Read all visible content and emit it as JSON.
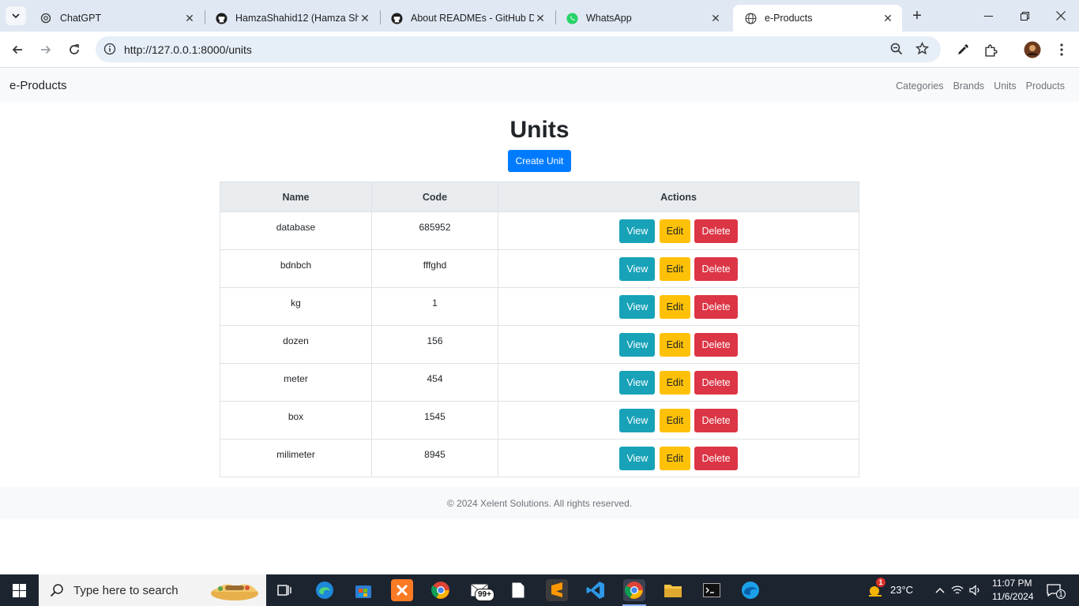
{
  "browser": {
    "tabs": [
      {
        "title": "ChatGPT",
        "icon": "chatgpt-icon"
      },
      {
        "title": "HamzaShahid12 (Hamza Sha",
        "icon": "github-icon"
      },
      {
        "title": "About READMEs - GitHub D",
        "icon": "github-icon"
      },
      {
        "title": "WhatsApp",
        "icon": "whatsapp-icon"
      },
      {
        "title": "e-Products",
        "icon": "globe-icon",
        "active": true
      }
    ],
    "url": "http://127.0.0.1:8000/units"
  },
  "navbar": {
    "brand": "e-Products",
    "links": [
      "Categories",
      "Brands",
      "Units",
      "Products"
    ]
  },
  "page": {
    "title": "Units",
    "create_button": "Create Unit"
  },
  "table": {
    "headers": [
      "Name",
      "Code",
      "Actions"
    ],
    "rows": [
      {
        "name": "database",
        "code": "685952"
      },
      {
        "name": "bdnbch",
        "code": "fffghd"
      },
      {
        "name": "kg",
        "code": "1"
      },
      {
        "name": "dozen",
        "code": "156"
      },
      {
        "name": "meter",
        "code": "454"
      },
      {
        "name": "box",
        "code": "1545"
      },
      {
        "name": "milimeter",
        "code": "8945"
      }
    ],
    "actions": {
      "view": "View",
      "edit": "Edit",
      "delete": "Delete"
    }
  },
  "footer": {
    "text": "© 2024 Xelent Solutions. All rights reserved."
  },
  "colors": {
    "primary": "#007bff",
    "info": "#17a2b8",
    "warning": "#ffc107",
    "danger": "#dc3545"
  },
  "taskbar": {
    "search_placeholder": "Type here to search",
    "badge": "99+",
    "weather_badge": "1",
    "temperature": "23°C",
    "time": "11:07 PM",
    "date": "11/6/2024",
    "notification_count": "1"
  }
}
